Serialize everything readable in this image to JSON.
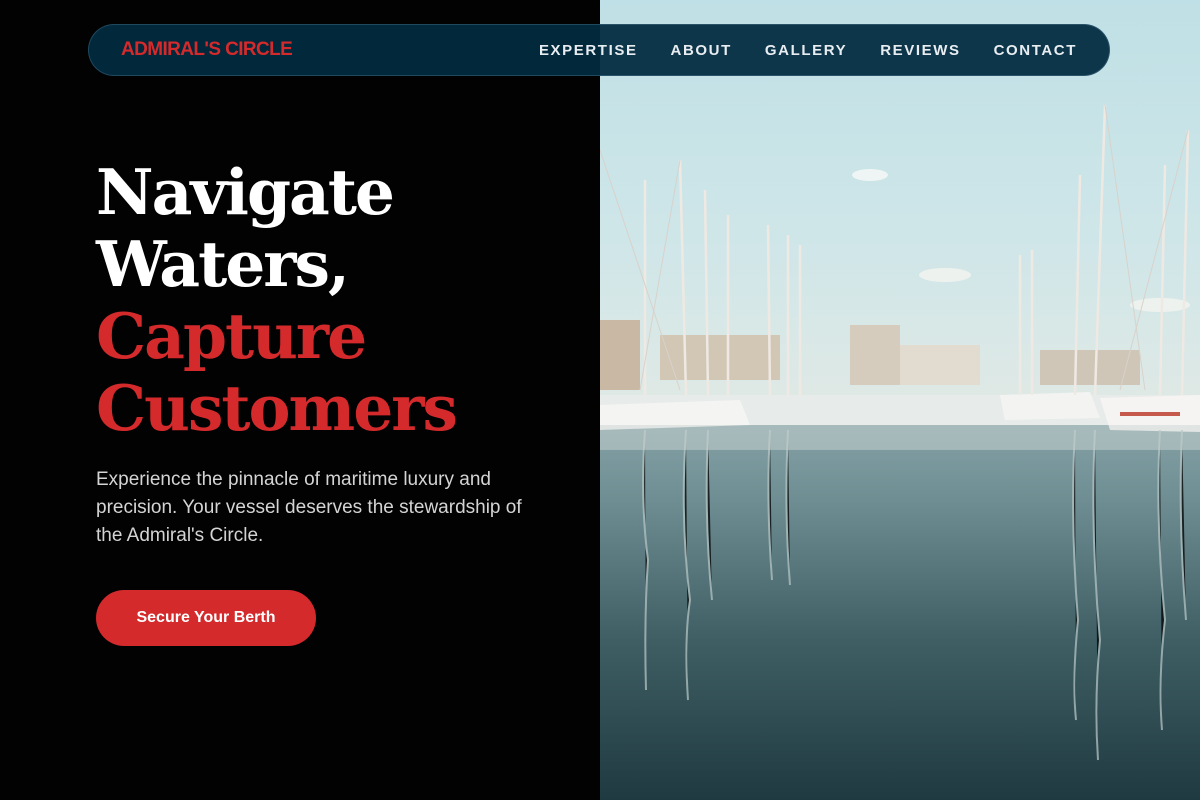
{
  "brand": {
    "name": "ADMIRAL'S CIRCLE"
  },
  "nav": {
    "items": [
      {
        "label": "EXPERTISE"
      },
      {
        "label": "ABOUT"
      },
      {
        "label": "GALLERY"
      },
      {
        "label": "REVIEWS"
      },
      {
        "label": "CONTACT"
      }
    ]
  },
  "hero": {
    "title_line1": "Navigate",
    "title_line2": "Waters,",
    "title_line3": "Capture",
    "title_line4": "Customers",
    "subtitle": "Experience the pinnacle of maritime luxury and precision. Your vessel deserves the stewardship of the Admiral's Circle.",
    "cta_label": "Secure Your Berth"
  },
  "colors": {
    "accent": "#d42a2c",
    "nav_background": "#022a40",
    "page_background": "#020202"
  }
}
